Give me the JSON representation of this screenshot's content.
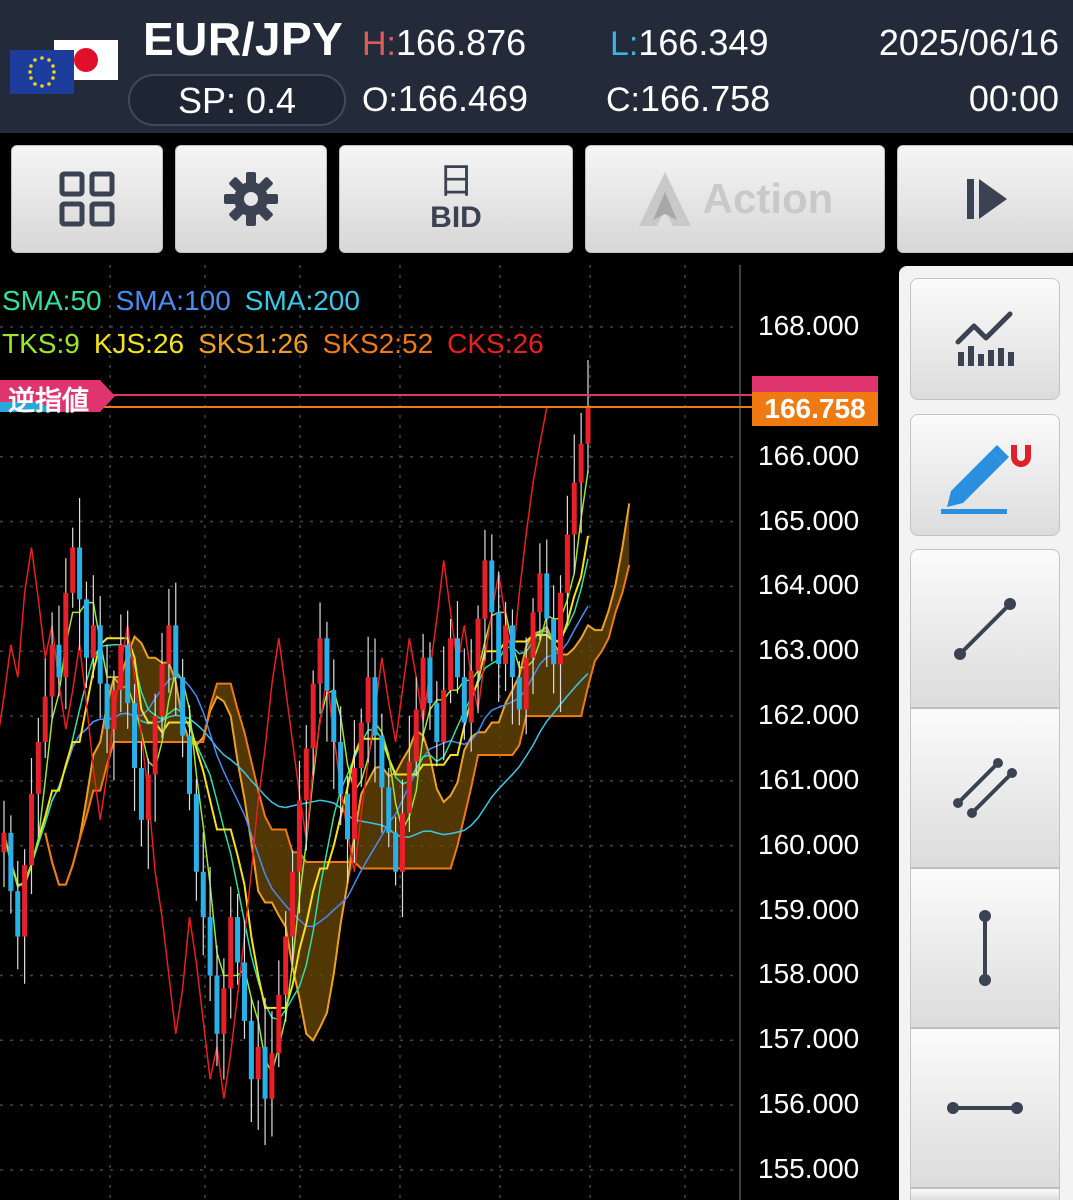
{
  "header": {
    "pair": "EUR/JPY",
    "spread": "SP: 0.4",
    "high_label": "H:",
    "high": "166.876",
    "low_label": "L:",
    "low": "166.349",
    "open_label": "O:",
    "open": "166.469",
    "close_label": "C:",
    "close": "166.758",
    "date": "2025/06/16",
    "time": "00:00"
  },
  "toolbar": {
    "grid_icon": "grid-icon",
    "settings_icon": "gear-icon",
    "timeframe": "日",
    "price_type": "BID",
    "action_label": "Action",
    "play_icon": "play-next-icon"
  },
  "legend": {
    "sma": [
      {
        "label": "SMA:50",
        "color": "#2fe0a0"
      },
      {
        "label": "SMA:100",
        "color": "#4a8cf0"
      },
      {
        "label": "SMA:200",
        "color": "#3ac8e8"
      }
    ],
    "ichimoku": [
      {
        "label": "TKS:9",
        "color": "#9be82a"
      },
      {
        "label": "KJS:26",
        "color": "#f4e21a"
      },
      {
        "label": "SKS1:26",
        "color": "#f0a020"
      },
      {
        "label": "SKS2:52",
        "color": "#f07a12"
      },
      {
        "label": "CKS:26",
        "color": "#e82020"
      }
    ]
  },
  "stop_order_label": "逆指値",
  "current_price_tag": "166.758",
  "chart_data": {
    "type": "candlestick",
    "ylim": [
      155.0,
      168.0
    ],
    "yticks": [
      "168.000",
      "166.000",
      "165.000",
      "164.000",
      "163.000",
      "162.000",
      "161.000",
      "160.000",
      "159.000",
      "158.000",
      "157.000",
      "156.000",
      "155.000"
    ],
    "last_close": 166.758,
    "closes": [
      160.2,
      159.3,
      158.6,
      159.7,
      160.8,
      161.6,
      162.3,
      163.1,
      162.6,
      163.9,
      164.6,
      163.8,
      162.9,
      163.4,
      162.5,
      161.8,
      162.4,
      163.1,
      162.2,
      161.2,
      160.4,
      161.1,
      162.0,
      162.8,
      163.4,
      162.6,
      161.7,
      160.8,
      159.6,
      158.9,
      158.0,
      157.1,
      157.8,
      158.9,
      158.2,
      157.3,
      156.4,
      156.9,
      156.1,
      156.8,
      157.7,
      158.6,
      159.6,
      160.7,
      161.5,
      162.5,
      163.2,
      162.4,
      161.6,
      160.8,
      160.1,
      161.2,
      161.9,
      162.6,
      161.7,
      160.9,
      160.2,
      159.6,
      160.5,
      161.3,
      162.1,
      162.9,
      162.2,
      161.6,
      162.4,
      163.2,
      162.6,
      161.9,
      162.7,
      163.5,
      164.4,
      163.6,
      162.8,
      163.4,
      162.6,
      162.1,
      162.9,
      163.6,
      164.2,
      163.5,
      162.8,
      163.9,
      164.8,
      165.6,
      166.2,
      166.758
    ]
  },
  "drawing_tools": [
    "indicator-chart-icon",
    "drawing-magnet-icon",
    "trendline-icon",
    "parallel-lines-icon",
    "vertical-line-icon",
    "horizontal-line-icon"
  ]
}
